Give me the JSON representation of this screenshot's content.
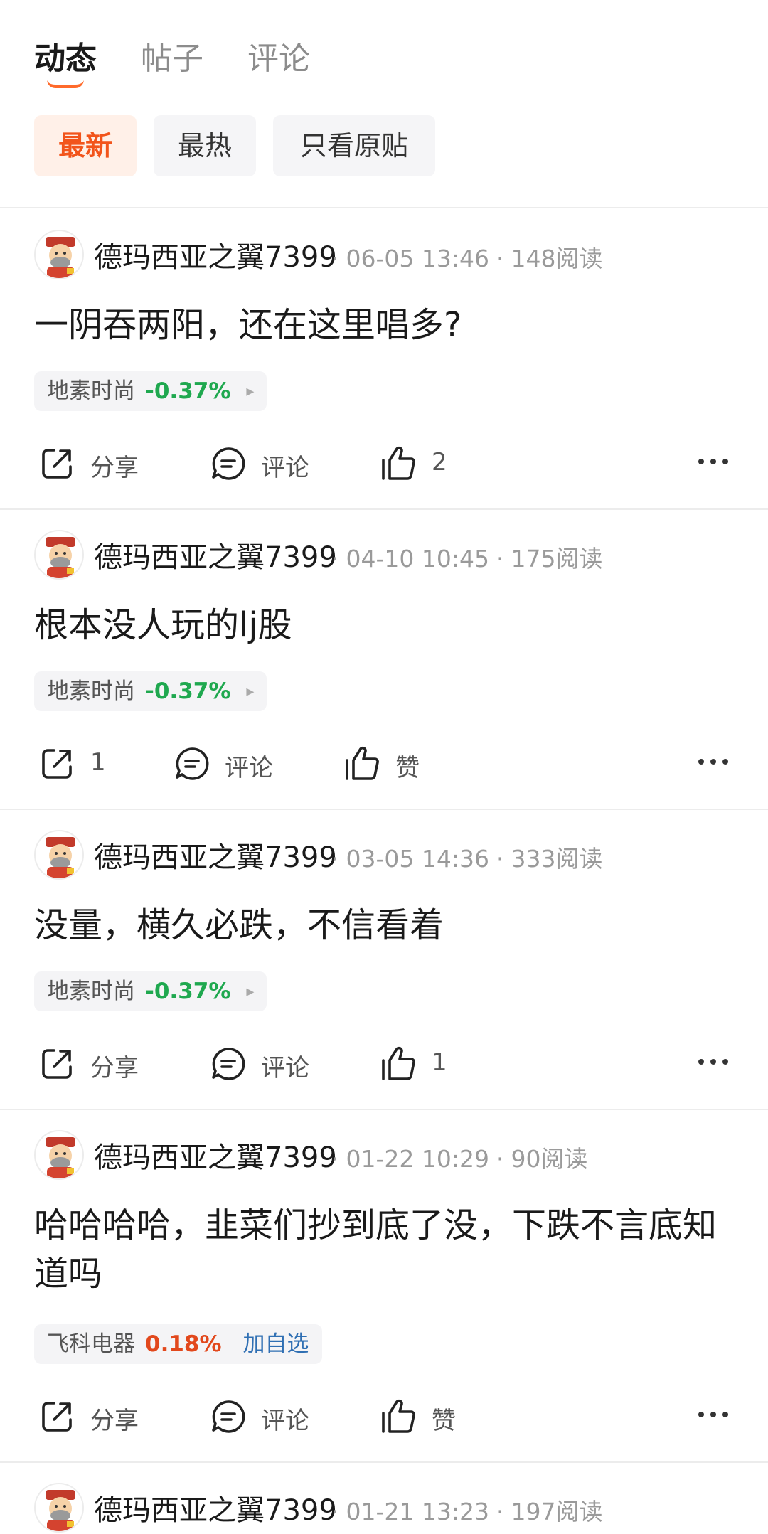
{
  "tabs": [
    {
      "label": "动态",
      "active": true
    },
    {
      "label": "帖子",
      "active": false
    },
    {
      "label": "评论",
      "active": false
    }
  ],
  "filters": [
    {
      "label": "最新",
      "active": true
    },
    {
      "label": "最热",
      "active": false
    },
    {
      "label": "只看原贴",
      "active": false
    }
  ],
  "colors": {
    "accent": "#ff6a2b",
    "down": "#1fa84f",
    "up": "#e2481c",
    "link": "#2f6fb3"
  },
  "posts": [
    {
      "author": "德玛西亚之翼7399",
      "time": "06-05 13:46",
      "reads": "148阅读",
      "content": "一阴吞两阳，还在这里唱多?",
      "stock": {
        "name": "地素时尚",
        "change": "-0.37%",
        "direction": "down",
        "trailing": "▸"
      },
      "share_label": "分享",
      "comment_label": "评论",
      "like_label": "2"
    },
    {
      "author": "德玛西亚之翼7399",
      "time": "04-10 10:45",
      "reads": "175阅读",
      "content": "根本没人玩的lj股",
      "stock": {
        "name": "地素时尚",
        "change": "-0.37%",
        "direction": "down",
        "trailing": "▸"
      },
      "share_label": "1",
      "comment_label": "评论",
      "like_label": "赞"
    },
    {
      "author": "德玛西亚之翼7399",
      "time": "03-05 14:36",
      "reads": "333阅读",
      "content": "没量，横久必跌，不信看着",
      "stock": {
        "name": "地素时尚",
        "change": "-0.37%",
        "direction": "down",
        "trailing": "▸"
      },
      "share_label": "分享",
      "comment_label": "评论",
      "like_label": "1"
    },
    {
      "author": "德玛西亚之翼7399",
      "time": "01-22 10:29",
      "reads": "90阅读",
      "content": "哈哈哈哈，韭菜们抄到底了没，下跌不言底知道吗",
      "stock": {
        "name": "飞科电器",
        "change": "0.18%",
        "direction": "up",
        "add_label": "加自选"
      },
      "share_label": "分享",
      "comment_label": "评论",
      "like_label": "赞"
    },
    {
      "author": "德玛西亚之翼7399",
      "time": "01-21 13:23",
      "reads": "197阅读"
    }
  ],
  "icons": {
    "share": "share-icon",
    "comment": "comment-icon",
    "like": "thumbs-up-icon",
    "more": "more-icon"
  }
}
